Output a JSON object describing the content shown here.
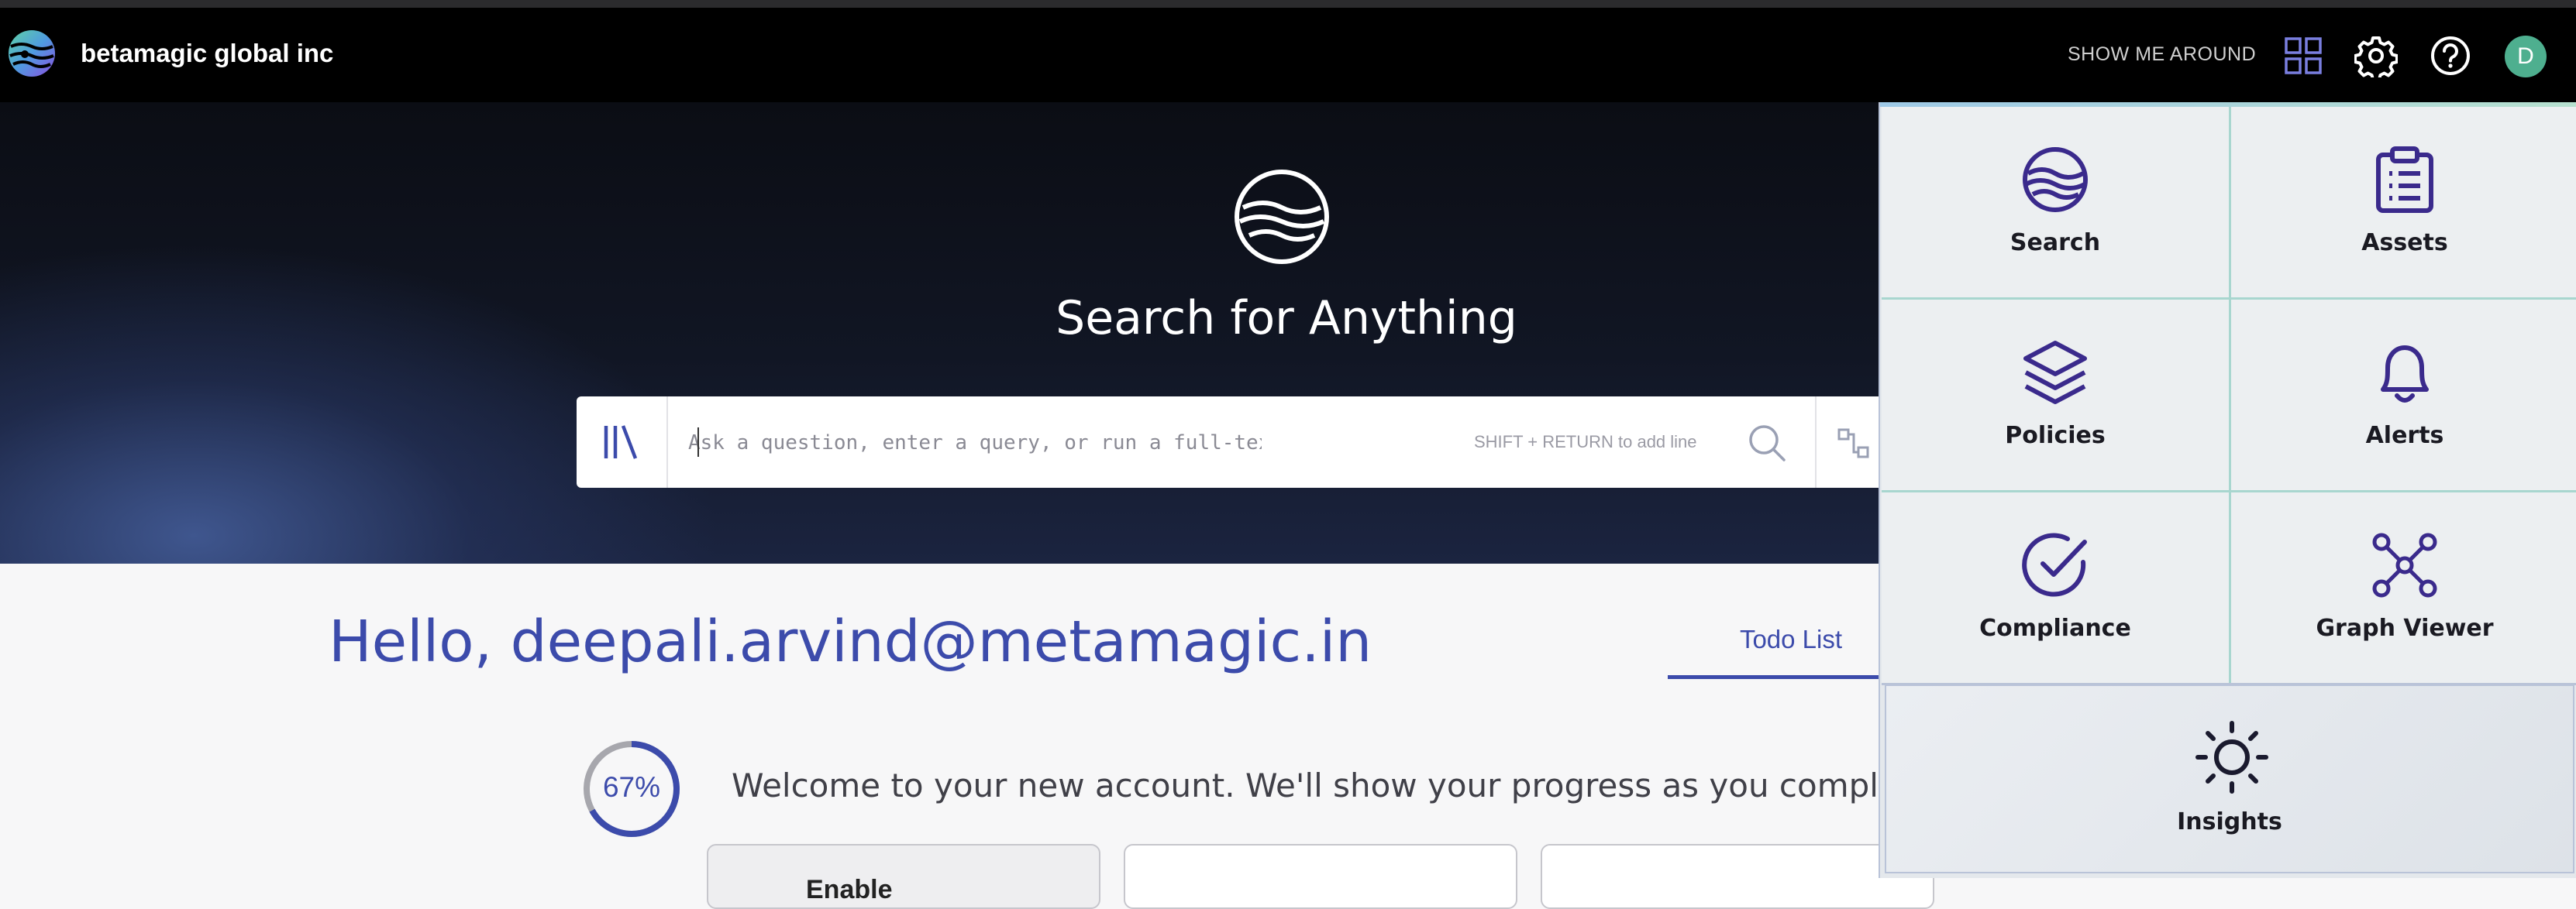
{
  "topbar": {
    "org_name": "betamagic global inc",
    "tour_label": "SHOW ME AROUND",
    "avatar_initial": "D",
    "icons": [
      "apps-grid-icon",
      "gear-icon",
      "help-icon"
    ]
  },
  "hero": {
    "title": "Search for Anything",
    "search": {
      "placeholder": "Ask a question, enter a query, or run a full-text search",
      "value": "",
      "hint": "SHIFT + RETURN to add line"
    }
  },
  "home": {
    "greeting": "Hello, deepali.arvind@metamagic.in",
    "tabs": [
      {
        "label": "Todo List",
        "active": true
      }
    ],
    "progress": {
      "percent": 67,
      "label": "67%"
    },
    "welcome": "Welcome to your new account. We'll show your progress as you complete each t",
    "cards": [
      {
        "label": "Enable"
      },
      {
        "label": ""
      },
      {
        "label": ""
      }
    ]
  },
  "app_menu": {
    "items": [
      {
        "label": "Search",
        "icon": "search-brand-icon"
      },
      {
        "label": "Assets",
        "icon": "clipboard-icon"
      },
      {
        "label": "Policies",
        "icon": "layers-icon"
      },
      {
        "label": "Alerts",
        "icon": "bell-icon"
      },
      {
        "label": "Compliance",
        "icon": "check-circle-icon"
      },
      {
        "label": "Graph Viewer",
        "icon": "graph-icon"
      },
      {
        "label": "Insights",
        "icon": "sun-icon"
      }
    ]
  },
  "colors": {
    "accent": "#3c4bab",
    "menu_icon": "#3a2a8c",
    "avatar": "#4eaf8f",
    "topbar": "#000000"
  }
}
